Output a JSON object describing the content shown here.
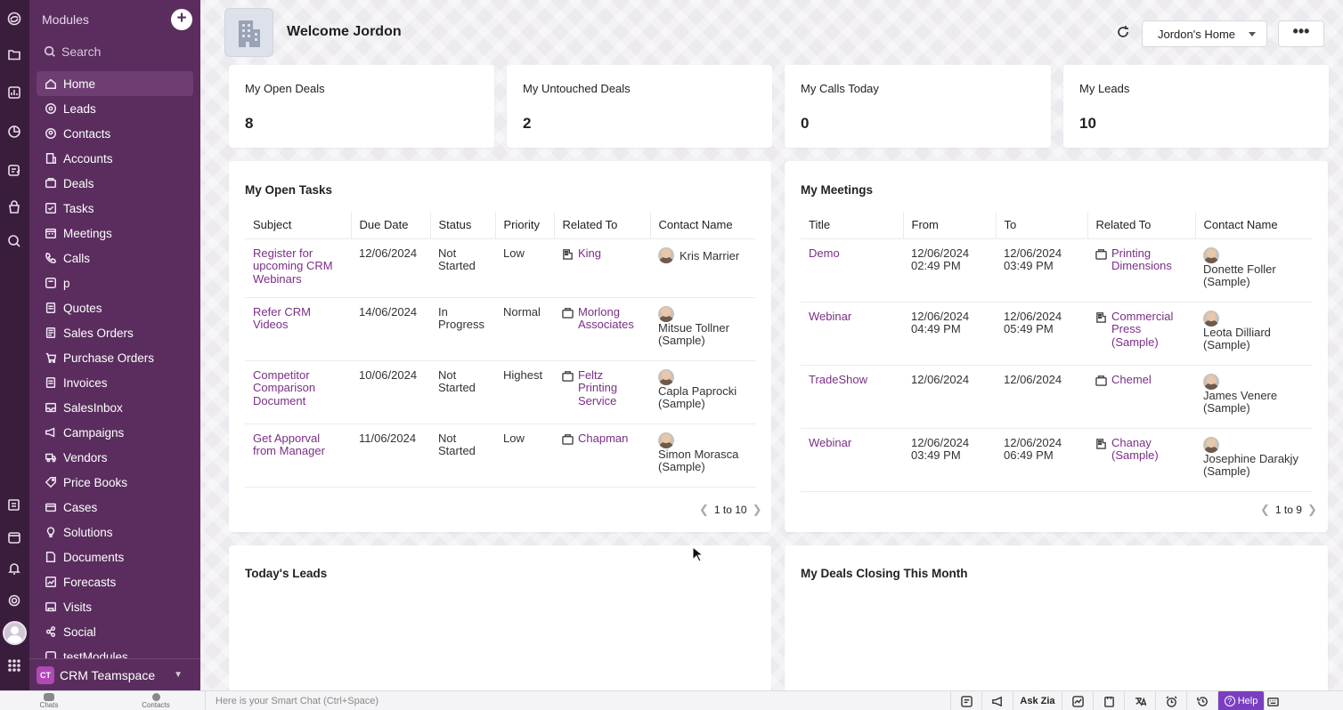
{
  "sidebar": {
    "header": "Modules",
    "search_placeholder": "Search",
    "items": [
      {
        "label": "Home",
        "icon": "home-icon"
      },
      {
        "label": "Leads",
        "icon": "leads-icon"
      },
      {
        "label": "Contacts",
        "icon": "contacts-icon"
      },
      {
        "label": "Accounts",
        "icon": "accounts-icon"
      },
      {
        "label": "Deals",
        "icon": "deals-icon"
      },
      {
        "label": "Tasks",
        "icon": "tasks-icon"
      },
      {
        "label": "Meetings",
        "icon": "meetings-icon"
      },
      {
        "label": "Calls",
        "icon": "calls-icon"
      },
      {
        "label": "p",
        "icon": "module-icon"
      },
      {
        "label": "Quotes",
        "icon": "quotes-icon"
      },
      {
        "label": "Sales Orders",
        "icon": "sales-orders-icon"
      },
      {
        "label": "Purchase Orders",
        "icon": "purchase-orders-icon"
      },
      {
        "label": "Invoices",
        "icon": "invoices-icon"
      },
      {
        "label": "SalesInbox",
        "icon": "salesinbox-icon"
      },
      {
        "label": "Campaigns",
        "icon": "campaigns-icon"
      },
      {
        "label": "Vendors",
        "icon": "vendors-icon"
      },
      {
        "label": "Price Books",
        "icon": "price-books-icon"
      },
      {
        "label": "Cases",
        "icon": "cases-icon"
      },
      {
        "label": "Solutions",
        "icon": "solutions-icon"
      },
      {
        "label": "Documents",
        "icon": "documents-icon"
      },
      {
        "label": "Forecasts",
        "icon": "forecasts-icon"
      },
      {
        "label": "Visits",
        "icon": "visits-icon"
      },
      {
        "label": "Social",
        "icon": "social-icon"
      },
      {
        "label": "testModules",
        "icon": "module-icon"
      }
    ],
    "teamspace": {
      "badge": "CT",
      "label": "CRM Teamspace"
    }
  },
  "header": {
    "welcome": "Welcome Jordon",
    "home_select": "Jordon's Home",
    "more": "•••"
  },
  "kpis": [
    {
      "label": "My Open Deals",
      "value": "8"
    },
    {
      "label": "My Untouched Deals",
      "value": "2"
    },
    {
      "label": "My Calls Today",
      "value": "0"
    },
    {
      "label": "My Leads",
      "value": "10"
    }
  ],
  "tasks": {
    "title": "My Open Tasks",
    "columns": [
      "Subject",
      "Due Date",
      "Status",
      "Priority",
      "Related To",
      "Contact Name"
    ],
    "rows": [
      {
        "subject": "Register for upcoming CRM Webinars",
        "due": "12/06/2024",
        "status": "Not Started",
        "priority": "Low",
        "related": "King",
        "related_icon": "building-icon",
        "contact": "Kris Marrier"
      },
      {
        "subject": "Refer CRM Videos",
        "due": "14/06/2024",
        "status": "In Progress",
        "priority": "Normal",
        "related": "Morlong Associates",
        "related_icon": "deal-icon",
        "contact": "Mitsue Tollner (Sample)"
      },
      {
        "subject": "Competitor Comparison Document",
        "due": "10/06/2024",
        "status": "Not Started",
        "priority": "Highest",
        "related": "Feltz Printing Service",
        "related_icon": "deal-icon",
        "contact": "Capla Paprocki (Sample)"
      },
      {
        "subject": "Get Apporval from Manager",
        "due": "11/06/2024",
        "status": "Not Started",
        "priority": "Low",
        "related": "Chapman",
        "related_icon": "deal-icon",
        "contact": "Simon Morasca (Sample)"
      }
    ],
    "pager": "1 to 10"
  },
  "meetings": {
    "title": "My Meetings",
    "columns": [
      "Title",
      "From",
      "To",
      "Related To",
      "Contact Name"
    ],
    "rows": [
      {
        "title": "Demo",
        "from": "12/06/2024 02:49 PM",
        "to": "12/06/2024 03:49 PM",
        "related": "Printing Dimensions",
        "related_icon": "deal-icon",
        "contact": "Donette Foller (Sample)"
      },
      {
        "title": "Webinar",
        "from": "12/06/2024 04:49 PM",
        "to": "12/06/2024 05:49 PM",
        "related": "Commercial Press (Sample)",
        "related_icon": "building-icon",
        "contact": "Leota Dilliard (Sample)"
      },
      {
        "title": "TradeShow",
        "from": "12/06/2024",
        "to": "12/06/2024",
        "related": "Chemel",
        "related_icon": "deal-icon",
        "contact": "James Venere (Sample)"
      },
      {
        "title": "Webinar",
        "from": "12/06/2024 03:49 PM",
        "to": "12/06/2024 06:49 PM",
        "related": "Chanay (Sample)",
        "related_icon": "building-icon",
        "contact": "Josephine Darakjy (Sample)"
      }
    ],
    "pager": "1 to 9"
  },
  "panels": {
    "todays_leads": "Today's Leads",
    "deals_closing": "My Deals Closing This Month"
  },
  "bottombar": {
    "chats": "Chats",
    "contacts": "Contacts",
    "smart_chat": "Here is your Smart Chat (Ctrl+Space)",
    "ask_zia": "Ask Zia",
    "help": "Help"
  },
  "colors": {
    "sidebar": "#5a2d5e",
    "rail": "#3a1d3c",
    "link": "#7a2f86",
    "help": "#7a3fc0"
  }
}
